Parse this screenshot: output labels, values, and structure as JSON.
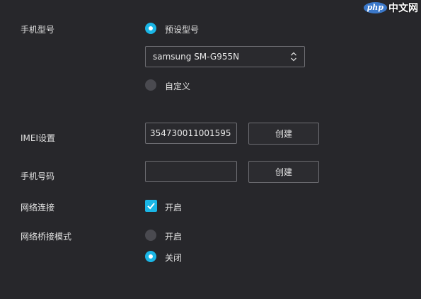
{
  "watermark": {
    "badge": "php",
    "site": "中文网"
  },
  "model": {
    "label": "手机型号",
    "preset_label": "预设型号",
    "preset_selected": true,
    "select_value": "samsung SM-G955N",
    "custom_label": "自定义",
    "custom_selected": false
  },
  "imei": {
    "label": "IMEI设置",
    "value": "354730011001595",
    "create_label": "创建"
  },
  "phone": {
    "label": "手机号码",
    "value": "",
    "create_label": "创建"
  },
  "network": {
    "label": "网络连接",
    "enable_label": "开启",
    "enabled": true
  },
  "bridge": {
    "label": "网络桥接模式",
    "on_label": "开启",
    "off_label": "关闭",
    "selected": "off"
  },
  "colors": {
    "background": "#27272b",
    "accent": "#1ab6e6",
    "border": "#6d6d72"
  }
}
